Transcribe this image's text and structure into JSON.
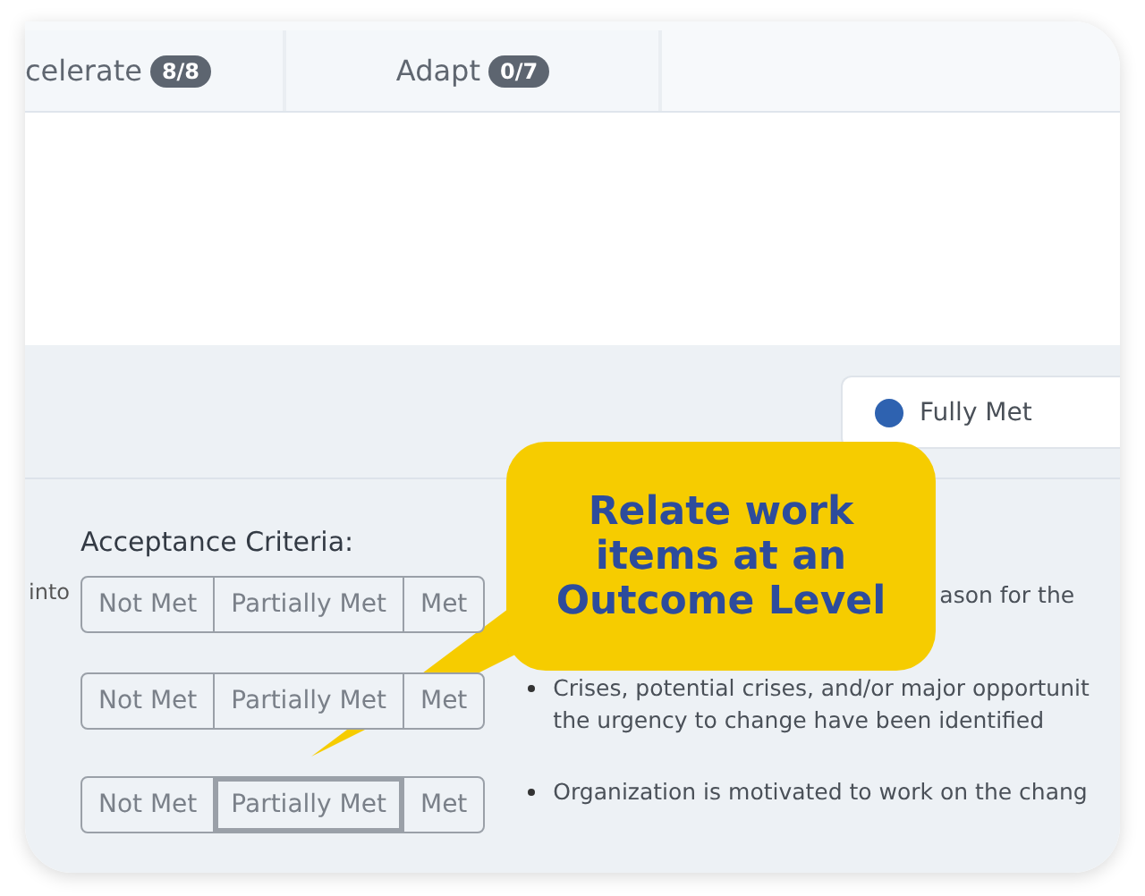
{
  "tabs": [
    {
      "label": "celerate",
      "count": "8/8",
      "selected": false
    },
    {
      "label": "Adapt",
      "count": "0/7",
      "selected": false
    }
  ],
  "legend": [
    {
      "label": "Fully Met",
      "color": "#2e62b0"
    }
  ],
  "acceptance": {
    "heading": "Acceptance Criteria:",
    "rows": [
      {
        "lead": "into",
        "options": [
          {
            "label": "Not Met",
            "selected": false
          },
          {
            "label": "Partially Met",
            "selected": false
          },
          {
            "label": "Met",
            "selected": false
          }
        ],
        "bullet": false,
        "lines": [
          "ason for the"
        ]
      },
      {
        "options": [
          {
            "label": "Not Met",
            "selected": false
          },
          {
            "label": "Partially Met",
            "selected": false
          },
          {
            "label": "Met",
            "selected": false
          }
        ],
        "bullet": true,
        "lines": [
          "Crises, potential crises, and/or major opportunit",
          "the urgency to change have been identified"
        ]
      },
      {
        "options": [
          {
            "label": "Not Met",
            "selected": false
          },
          {
            "label": "Partially Met",
            "selected": true
          },
          {
            "label": "Met",
            "selected": false
          }
        ],
        "bullet": true,
        "lines": [
          "Organization is motivated to work on the chang"
        ]
      }
    ]
  },
  "callout": {
    "text": "Relate work items at an Outcome Level"
  }
}
